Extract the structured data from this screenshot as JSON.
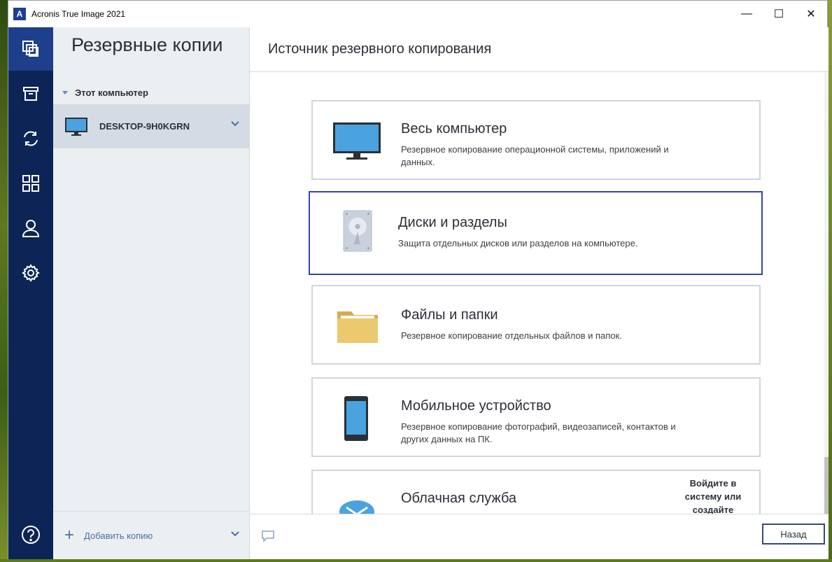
{
  "window": {
    "title": "Acronis True Image 2021"
  },
  "window_controls": {
    "minimize": "—",
    "maximize": "☐",
    "close": "✕"
  },
  "nav": {
    "items": [
      {
        "icon": "backup-copies-icon"
      },
      {
        "icon": "archive-icon"
      },
      {
        "icon": "sync-icon"
      },
      {
        "icon": "tools-grid-icon"
      },
      {
        "icon": "account-icon"
      },
      {
        "icon": "settings-gear-icon"
      }
    ],
    "help_icon": "help-icon"
  },
  "sidebar": {
    "title": "Резервные копии",
    "group_label": "Этот компьютер",
    "item_label": "DESKTOP-9H0KGRN",
    "add_label": "Добавить копию"
  },
  "main": {
    "title": "Источник резервного копирования",
    "cards": [
      {
        "title": "Весь компьютер",
        "desc": "Резервное копирование операционной системы, приложений и данных."
      },
      {
        "title": "Диски и разделы",
        "desc": "Защита отдельных дисков или разделов на компьютере."
      },
      {
        "title": "Файлы и папки",
        "desc": "Резервное копирование отдельных файлов и папок."
      },
      {
        "title": "Мобильное устройство",
        "desc": "Резервное копирование фотографий, видеозаписей, контактов и других данных на ПК."
      },
      {
        "title": "Облачная служба",
        "side": "Войдите в систему или создайте"
      }
    ],
    "back_button": "Назад"
  },
  "colors": {
    "nav_bg": "#0d2456",
    "nav_active": "#1e3f8c",
    "accent_border": "#3742b8"
  }
}
